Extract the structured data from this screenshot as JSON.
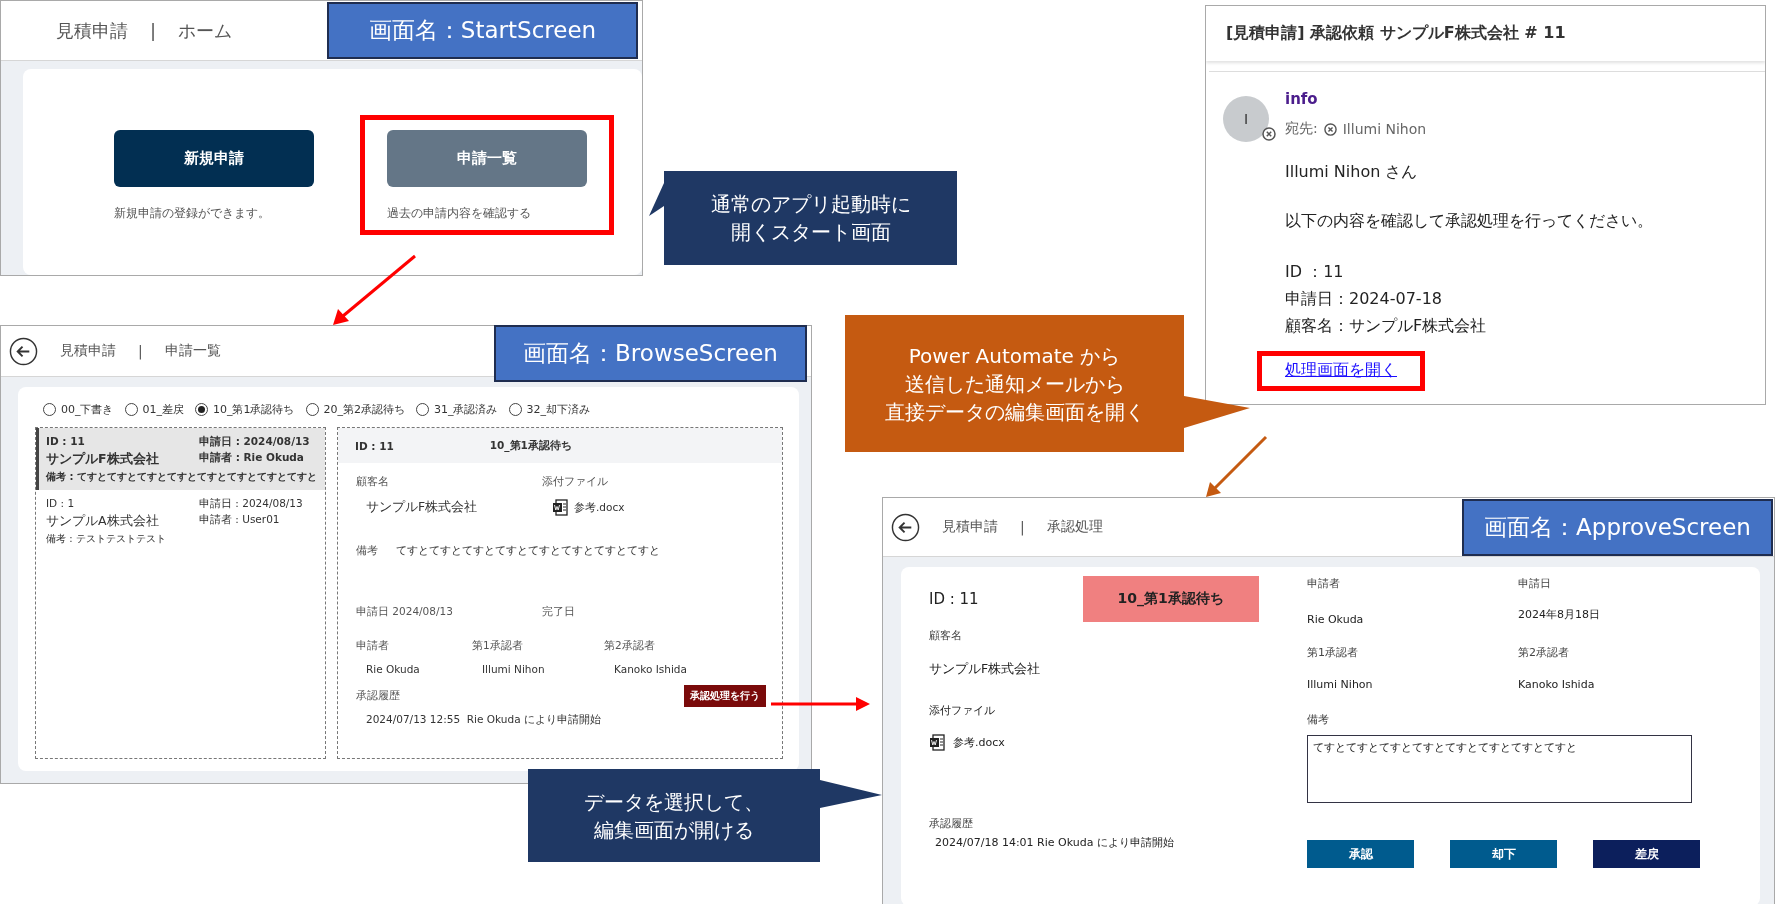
{
  "start_screen": {
    "label": "画面名：StartScreen",
    "app_title": "見積申請",
    "separator": "|",
    "page_title": "ホーム",
    "actions": [
      {
        "label": "新規申請",
        "description": "新規申請の登録ができます。",
        "highlighted": false,
        "color": "#022f52"
      },
      {
        "label": "申請一覧",
        "description": "過去の申請内容を確認する",
        "highlighted": true,
        "color": "#647687"
      }
    ]
  },
  "callouts": [
    {
      "kind": "navy",
      "lines": [
        "通常のアプリ起動時に",
        "開くスタート画面"
      ]
    },
    {
      "kind": "orange",
      "lines": [
        "Power Automate から",
        "送信した通知メールから",
        "直接データの編集画面を開く"
      ]
    },
    {
      "kind": "navy",
      "lines": [
        "データを選択して、",
        "編集画面が開ける"
      ]
    }
  ],
  "email": {
    "subject": "[見積申請] 承認依頼 サンプルF株式会社 # 11",
    "avatar": "I",
    "sender": "info",
    "to_label": "宛先:",
    "recipient": "Illumi Nihon",
    "greeting": "Illumi Nihon さん",
    "message": "以下の内容を確認して承認処理を行ってください。",
    "details": [
      "ID ：11",
      "申請日：2024-07-18",
      "顧客名：サンプルF株式会社"
    ],
    "link": "処理画面を開く",
    "link_highlighted": true
  },
  "browse_screen": {
    "label": "画面名：BrowseScreen",
    "app_title": "見積申請",
    "separator": "|",
    "page_title": "申請一覧",
    "statuses": [
      {
        "label": "00_下書き",
        "selected": false
      },
      {
        "label": "01_差戻",
        "selected": false
      },
      {
        "label": "10_第1承認待ち",
        "selected": true
      },
      {
        "label": "20_第2承認待ち",
        "selected": false
      },
      {
        "label": "31_承認済み",
        "selected": false
      },
      {
        "label": "32_却下済み",
        "selected": false
      }
    ],
    "items": [
      {
        "id": "ID : 11",
        "date": "申請日 : 2024/08/13",
        "customer": "サンプルF株式会社",
        "applicant": "申請者 : Rie Okuda",
        "note": "備考 : てすとてすとてすとてすとてすとてすとてすとてすと",
        "selected": true
      },
      {
        "id": "ID : 1",
        "date": "申請日 : 2024/08/13",
        "customer": "サンプルA株式会社",
        "applicant": "申請者 : User01",
        "note": "備考 : テストテストテスト",
        "selected": false
      }
    ],
    "detail": {
      "id": "ID : 11",
      "status": "10_第1承認待ち",
      "customer_label": "顧客名",
      "customer": "サンプルF株式会社",
      "attachment_label": "添付ファイル",
      "attachment": "参考.docx",
      "note_label": "備考",
      "note": "てすとてすとてすとてすとてすとてすとてすとてすと",
      "date_label": "申請日",
      "date": "2024/08/13",
      "completed_label": "完了日",
      "people": [
        {
          "role": "申請者",
          "name": "Rie Okuda"
        },
        {
          "role": "第1承認者",
          "name": "Illumi Nihon"
        },
        {
          "role": "第2承認者",
          "name": "Kanoko Ishida"
        }
      ],
      "history_label": "承認履歴",
      "history": [
        "2024/07/13 12:55  Rie Okuda により申請開始"
      ],
      "action": "承認処理を行う"
    }
  },
  "approve_screen": {
    "label": "画面名：ApproveScreen",
    "app_title": "見積申請",
    "separator": "|",
    "page_title": "承認処理",
    "id": "ID : 11",
    "status": "10_第1承認待ち",
    "customer_label": "顧客名",
    "customer": "サンプルF株式会社",
    "attachment_label": "添付ファイル",
    "attachment": "参考.docx",
    "history_label": "承認履歴",
    "history": [
      "2024/07/18 14:01 Rie Okuda により申請開始"
    ],
    "applicant_label": "申請者",
    "applicant": "Rie Okuda",
    "date_label": "申請日",
    "date": "2024年8月18日",
    "approver1_label": "第1承認者",
    "approver1": "Illumi Nihon",
    "approver2_label": "第2承認者",
    "approver2": "Kanoko Ishida",
    "note_label": "備考",
    "note": "てすとてすとてすとてすとてすとてすとてすとてすと",
    "buttons": [
      {
        "label": "承認",
        "color": "#005b8e"
      },
      {
        "label": "却下",
        "color": "#005b8e"
      },
      {
        "label": "差戻",
        "color": "#0c1f5c"
      }
    ]
  }
}
